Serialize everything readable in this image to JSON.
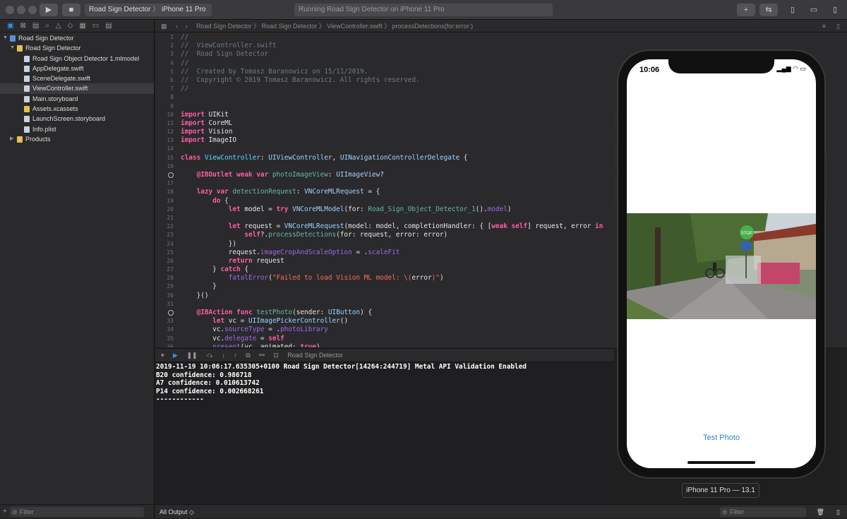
{
  "toolbar": {
    "scheme_target": "Road Sign Detector",
    "scheme_device": "iPhone 11 Pro",
    "activity_status": "Running Road Sign Detector on iPhone 11 Pro",
    "plus_label": "+"
  },
  "navigator": {
    "items": [
      {
        "label": "Road Sign Detector",
        "kind": "proj",
        "indent": 0,
        "disclosure": "▼"
      },
      {
        "label": "Road Sign Detector",
        "kind": "folder",
        "indent": 1,
        "disclosure": "▼"
      },
      {
        "label": "Road Sign Object Detector 1.mlmodel",
        "kind": "file",
        "indent": 2
      },
      {
        "label": "AppDelegate.swift",
        "kind": "file",
        "indent": 2
      },
      {
        "label": "SceneDelegate.swift",
        "kind": "file",
        "indent": 2
      },
      {
        "label": "ViewController.swift",
        "kind": "file",
        "indent": 2,
        "selected": true
      },
      {
        "label": "Main.storyboard",
        "kind": "file",
        "indent": 2
      },
      {
        "label": "Assets.xcassets",
        "kind": "folder",
        "indent": 2
      },
      {
        "label": "LaunchScreen.storyboard",
        "kind": "file",
        "indent": 2
      },
      {
        "label": "Info.plist",
        "kind": "file",
        "indent": 2
      },
      {
        "label": "Products",
        "kind": "folder",
        "indent": 1,
        "disclosure": "▶"
      }
    ],
    "filter_placeholder": "Filter"
  },
  "jumpbar": {
    "crumbs": [
      "Road Sign Detector",
      "Road Sign Detector",
      "ViewController.swift",
      "processDetections(for:error:)"
    ]
  },
  "code": [
    {
      "n": "1",
      "html": "<span class='c'>//</span>"
    },
    {
      "n": "2",
      "html": "<span class='c'>//  ViewController.swift</span>"
    },
    {
      "n": "3",
      "html": "<span class='c'>//  Road Sign Detector</span>"
    },
    {
      "n": "4",
      "html": "<span class='c'>//</span>"
    },
    {
      "n": "5",
      "html": "<span class='c'>//  Created by Tomasz Baranowicz on 15/11/2019.</span>"
    },
    {
      "n": "6",
      "html": "<span class='c'>//  Copyright © 2019 Tomasz Baranowicz. All rights reserved.</span>"
    },
    {
      "n": "7",
      "html": "<span class='c'>//</span>"
    },
    {
      "n": "8",
      "html": ""
    },
    {
      "n": "9",
      "html": ""
    },
    {
      "n": "10",
      "html": "<span class='k'>import</span> UIKit"
    },
    {
      "n": "11",
      "html": "<span class='k'>import</span> CoreML"
    },
    {
      "n": "12",
      "html": "<span class='k'>import</span> Vision"
    },
    {
      "n": "13",
      "html": "<span class='k'>import</span> ImageIO"
    },
    {
      "n": "14",
      "html": ""
    },
    {
      "n": "15",
      "html": "<span class='k'>class</span> <span class='nm'>ViewController</span>: <span class='t'>UIViewController</span>, <span class='t'>UINavigationControllerDelegate</span> {"
    },
    {
      "n": "16",
      "html": ""
    },
    {
      "n": "",
      "html": "    <span class='k'>@IBOutlet</span> <span class='k'>weak</span> <span class='k'>var</span> <span class='f'>photoImageView</span>: <span class='t'>UIImageView</span>?",
      "outlet": true
    },
    {
      "n": "17",
      "html": ""
    },
    {
      "n": "18",
      "html": "    <span class='k'>lazy</span> <span class='k'>var</span> <span class='f'>detectionRequest</span>: <span class='t'>VNCoreMLRequest</span> = {"
    },
    {
      "n": "19",
      "html": "        <span class='k'>do</span> {"
    },
    {
      "n": "20",
      "html": "            <span class='k'>let</span> model = <span class='k'>try</span> <span class='t'>VNCoreMLModel</span>(for: <span class='f'>Road_Sign_Object_Detector_1</span>().<span class='m'>model</span>)"
    },
    {
      "n": "21",
      "html": ""
    },
    {
      "n": "22",
      "html": "            <span class='k'>let</span> request = <span class='t'>VNCoreMLRequest</span>(model: model, completionHandler: { [<span class='k'>weak</span> <span class='k'>self</span>] request, error <span class='k'>in</span>"
    },
    {
      "n": "23",
      "html": "                <span class='k'>self</span>?.<span class='f'>processDetections</span>(for: request, error: error)"
    },
    {
      "n": "24",
      "html": "            })"
    },
    {
      "n": "25",
      "html": "            request.<span class='m'>imageCropAndScaleOption</span> = .<span class='m'>scaleFit</span>"
    },
    {
      "n": "26",
      "html": "            <span class='k'>return</span> request"
    },
    {
      "n": "27",
      "html": "        } <span class='k'>catch</span> {"
    },
    {
      "n": "28",
      "html": "            <span class='m'>fatalError</span>(<span class='s'>\"Failed to load Vision ML model: \\(</span>error<span class='s'>)\"</span>)"
    },
    {
      "n": "29",
      "html": "        }"
    },
    {
      "n": "30",
      "html": "    }()"
    },
    {
      "n": "31",
      "html": ""
    },
    {
      "n": "",
      "html": "    <span class='k'>@IBAction</span> <span class='k'>func</span> <span class='f'>testPhoto</span>(sender: <span class='t'>UIButton</span>) {",
      "outlet": true
    },
    {
      "n": "33",
      "html": "        <span class='k'>let</span> vc = <span class='t'>UIImagePickerController</span>()"
    },
    {
      "n": "34",
      "html": "        vc.<span class='m'>sourceType</span> = .<span class='m'>photoLibrary</span>"
    },
    {
      "n": "35",
      "html": "        vc.<span class='m'>delegate</span> = <span class='k'>self</span>"
    },
    {
      "n": "36",
      "html": "        <span class='m'>present</span>(vc, animated: <span class='k'>true</span>)"
    },
    {
      "n": "37",
      "html": "    }"
    }
  ],
  "debug_bar": {
    "target": "Road Sign Detector"
  },
  "console": [
    "2019-11-19 10:06:17.635305+0100 Road Sign Detector[14264:244719] Metal API Validation Enabled",
    "B20 confidence: 0.986718",
    "A7 confidence: 0.010613742",
    "P14 confidence: 0.002668261",
    "------------"
  ],
  "console_bar": {
    "output": "All Output ◇",
    "filter_placeholder": "Filter"
  },
  "simulator": {
    "time": "10:06",
    "status_icons": "▂▄▆ ◠ ▭",
    "sign_stop": "STOP",
    "test_button": "Test Photo",
    "device_label": "iPhone 11 Pro — 13.1"
  }
}
